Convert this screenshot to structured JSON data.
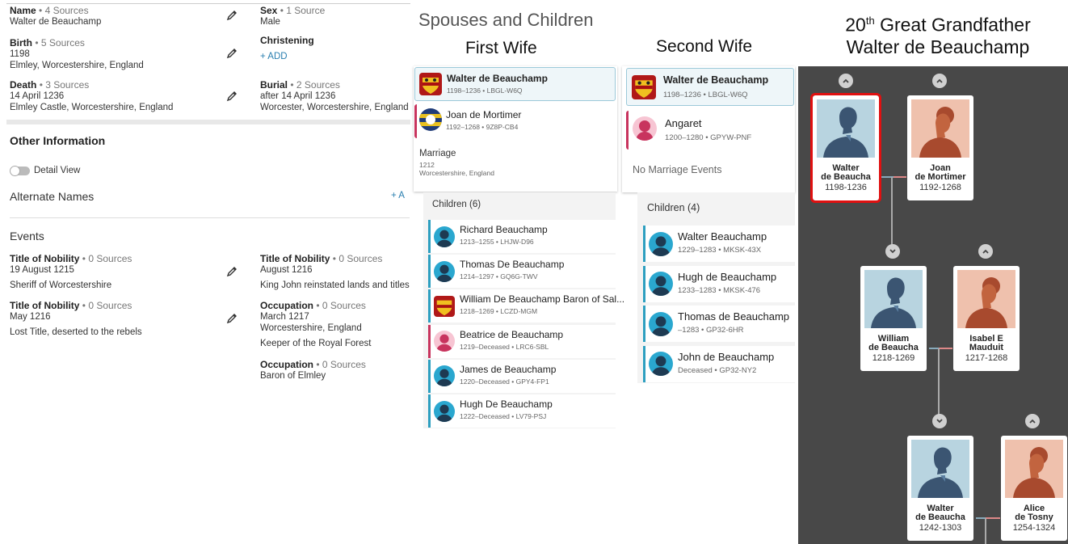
{
  "vitals": {
    "name": {
      "label": "Name",
      "sources": "• 4 Sources",
      "value": "Walter de Beauchamp"
    },
    "sex": {
      "label": "Sex",
      "sources": "• 1 Source",
      "value": "Male"
    },
    "birth": {
      "label": "Birth",
      "sources": "• 5 Sources",
      "date": "1198",
      "place": "Elmley, Worcestershire, England"
    },
    "christening": {
      "label": "Christening",
      "add": "+ ADD"
    },
    "death": {
      "label": "Death",
      "sources": "• 3 Sources",
      "date": "14 April 1236",
      "place": "Elmley Castle, Worcestershire, England"
    },
    "burial": {
      "label": "Burial",
      "sources": "• 2 Sources",
      "date": "after 14 April 1236",
      "place": "Worcester, Worcestershire, England"
    }
  },
  "other": {
    "title": "Other Information",
    "detail_view": "Detail View",
    "alt_names": "Alternate Names",
    "alt_add": "+ A",
    "events_title": "Events"
  },
  "events": [
    {
      "label": "Title of Nobility",
      "sources": "• 0 Sources",
      "date": "19 August 1215",
      "place": "",
      "desc": "Sheriff of Worcestershire"
    },
    {
      "label": "Title of Nobility",
      "sources": "• 0 Sources",
      "date": "August 1216",
      "place": "",
      "desc": "King John reinstated lands and titles"
    },
    {
      "label": "Title of Nobility",
      "sources": "• 0 Sources",
      "date": "May 1216",
      "place": "",
      "desc": "Lost Title, deserted to the rebels"
    },
    {
      "label": "Occupation",
      "sources": "• 0 Sources",
      "date": "March 1217",
      "place": "Worcestershire, England",
      "desc": "Keeper of the Royal Forest"
    },
    {
      "label": "Occupation",
      "sources": "• 0 Sources",
      "date": "",
      "place": "",
      "desc": "Baron of Elmley"
    }
  ],
  "spouses": {
    "title": "Spouses and Children",
    "first": {
      "heading": "First Wife",
      "husband": {
        "name": "Walter de Beauchamp",
        "meta": "1198–1236 • LBGL-W6Q"
      },
      "wife": {
        "name": "Joan de Mortimer",
        "meta": "1192–1268 • 9Z8P-CB4"
      },
      "marriage": {
        "label": "Marriage",
        "date": "1212",
        "place": "Worcestershire, England"
      },
      "children_label": "Children (6)",
      "children": [
        {
          "name": "Richard Beauchamp",
          "meta": "1213–1255 • LHJW-D96"
        },
        {
          "name": "Thomas De Beauchamp",
          "meta": "1214–1297 • GQ6G-TWV"
        },
        {
          "name": "William De Beauchamp Baron of Sal...",
          "meta": "1218–1269 • LCZD-MGM"
        },
        {
          "name": "Beatrice de Beauchamp",
          "meta": "1219–Deceased • LRC6-SBL"
        },
        {
          "name": "James de Beauchamp",
          "meta": "1220–Deceased • GPY4-FP1"
        },
        {
          "name": "Hugh De Beauchamp",
          "meta": "1222–Deceased • LV79-PSJ"
        }
      ]
    },
    "second": {
      "heading": "Second Wife",
      "husband": {
        "name": "Walter de Beauchamp",
        "meta": "1198–1236 • LBGL-W6Q"
      },
      "wife": {
        "name": "Angaret",
        "meta": "1200–1280 • GPYW-PNF"
      },
      "no_marriage": "No Marriage Events",
      "children_label": "Children (4)",
      "children": [
        {
          "name": "Walter Beauchamp",
          "meta": "1229–1283 • MKSK-43X"
        },
        {
          "name": "Hugh de Beauchamp",
          "meta": "1233–1283 • MKSK-476"
        },
        {
          "name": "Thomas de Beauchamp",
          "meta": "–1283 • GP32-6HR"
        },
        {
          "name": "John de Beauchamp",
          "meta": "Deceased • GP32-NY2"
        }
      ]
    }
  },
  "tree": {
    "title_num": "20",
    "title_sup": "th",
    "title_rest": " Great Grandfather",
    "title_name": "Walter de Beauchamp",
    "people": [
      {
        "line1": "Walter",
        "line2": "de Beaucha",
        "years": "1198-1236"
      },
      {
        "line1": "Joan",
        "line2": "de Mortimer",
        "years": "1192-1268"
      },
      {
        "line1": "William",
        "line2": "de Beaucha",
        "years": "1218-1269"
      },
      {
        "line1": "Isabel E",
        "line2": "Mauduit",
        "years": "1217-1268"
      },
      {
        "line1": "Walter",
        "line2": "de Beaucha",
        "years": "1242-1303"
      },
      {
        "line1": "Alice",
        "line2": "de Tosny",
        "years": "1254-1324"
      }
    ]
  },
  "colors": {
    "accent": "#2d9fc0",
    "female": "#c8345e",
    "tree_bg": "#484848",
    "selected": "#e01010",
    "male_bg": "#b8d4e0",
    "female_bg": "#efc1ad"
  },
  "icons": [
    "pencil-icon",
    "toggle-icon",
    "chevron-up-icon",
    "chevron-down-icon",
    "male-silhouette-icon",
    "female-silhouette-icon",
    "coat-of-arms-icon"
  ]
}
